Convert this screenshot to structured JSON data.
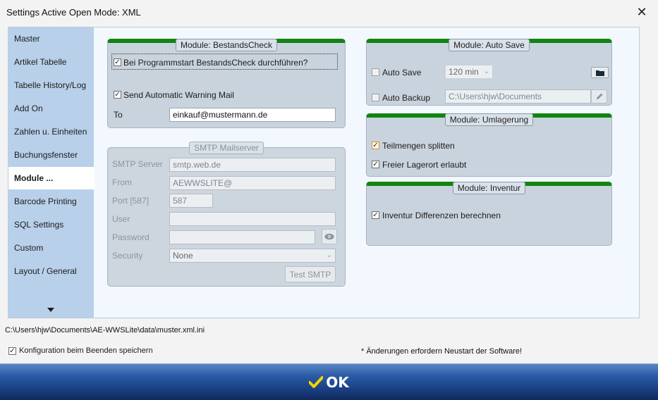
{
  "window": {
    "title": "Settings Active Open Mode: XML",
    "close_glyph": "✕"
  },
  "sidebar": {
    "items": [
      {
        "label": "Master"
      },
      {
        "label": "Artikel Tabelle"
      },
      {
        "label": "Tabelle History/Log"
      },
      {
        "label": "Add On"
      },
      {
        "label": "Zahlen u. Einheiten"
      },
      {
        "label": "Buchungsfenster"
      },
      {
        "label": "Module ..."
      },
      {
        "label": "Barcode Printing"
      },
      {
        "label": "SQL Settings"
      },
      {
        "label": "Custom"
      },
      {
        "label": "Layout / General"
      }
    ],
    "active_index": 6
  },
  "bestandscheck": {
    "title": "Module: BestandsCheck",
    "startup_check": {
      "label": "Bei Programmstart BestandsCheck durchführen?",
      "checked": true
    },
    "warning_mail": {
      "label": "Send Automatic Warning Mail",
      "checked": true
    },
    "to_label": "To",
    "to_value": "einkauf@mustermann.de"
  },
  "smtp": {
    "title": "SMTP Mailserver",
    "server_label": "SMTP Server",
    "server_value": "smtp.web.de",
    "from_label": "From",
    "from_value": "AEWWSLITE@",
    "port_label": "Port [587]",
    "port_value": "587",
    "user_label": "User",
    "user_value": "",
    "password_label": "Password",
    "password_value": "",
    "security_label": "Security",
    "security_value": "None",
    "test_button": "Test SMTP"
  },
  "autosave": {
    "title": "Module: Auto Save",
    "auto_save": {
      "label": "Auto Save",
      "checked": false
    },
    "interval_value": "120 min",
    "auto_backup": {
      "label": "Auto Backup",
      "checked": false
    },
    "backup_path": "C:\\Users\\hjw\\Documents"
  },
  "umlagerung": {
    "title": "Module: Umlagerung",
    "teilmengen": {
      "label": "Teilmengen splitten",
      "checked": true
    },
    "freier_lagerort": {
      "label": "Freier Lagerort erlaubt",
      "checked": true
    }
  },
  "inventur": {
    "title": "Module: Inventur",
    "differenzen": {
      "label": "Inventur Differenzen berechnen",
      "checked": true
    }
  },
  "footer": {
    "config_path": "C:\\Users\\hjw\\Documents\\AE-WWSLite\\data\\muster.xml.ini",
    "save_on_exit": {
      "label": "Konfiguration beim Beenden speichern",
      "checked": true
    },
    "restart_note": "* Änderungen erfordern Neustart der Software!",
    "ok_label": "OK"
  },
  "colors": {
    "group_header": "#118411",
    "sidebar_bg": "#b8d0ea",
    "ok_bar": "#1a3f82",
    "ok_check": "#f2d500"
  }
}
